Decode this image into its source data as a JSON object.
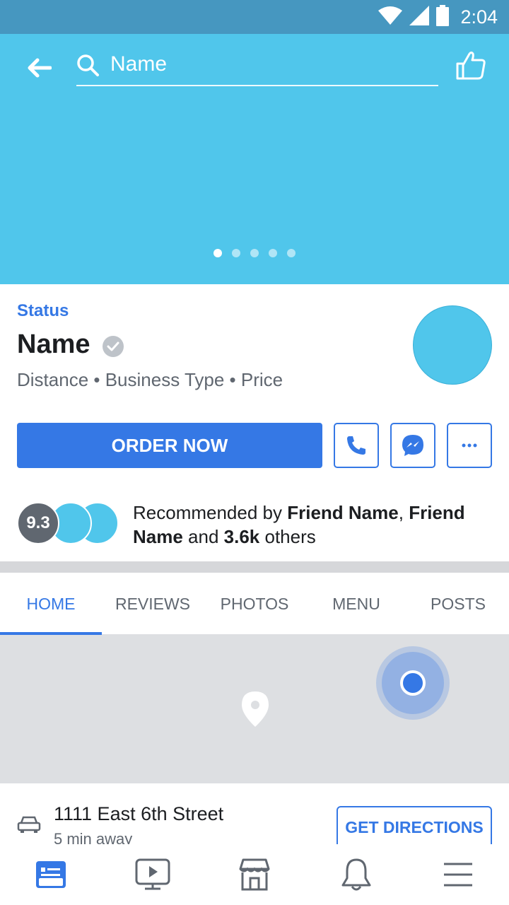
{
  "statusbar": {
    "time": "2:04",
    "icons": [
      "wifi-icon",
      "signal-icon",
      "battery-icon"
    ]
  },
  "header": {
    "search_text": "Name",
    "carousel": {
      "count": 5,
      "active": 0
    }
  },
  "info": {
    "status": "Status",
    "name": "Name",
    "meta": "Distance • Business Type • Price",
    "order_label": "ORDER NOW"
  },
  "recommend": {
    "score": "9.3",
    "prefix": "Recommended by ",
    "friend1": "Friend Name",
    "sep": ", ",
    "friend2": "Friend Name",
    "middle": " and ",
    "count": "3.6k",
    "suffix": " others"
  },
  "tabs": [
    {
      "label": "HOME",
      "active": true
    },
    {
      "label": "REVIEWS"
    },
    {
      "label": "PHOTOS"
    },
    {
      "label": "MENU"
    },
    {
      "label": "POSTS"
    }
  ],
  "address": {
    "line": "1111 East 6th Street",
    "sub": "5 min away",
    "directions_label": "GET DIRECTIONS"
  },
  "bottomnav": [
    "news-feed-icon",
    "watch-icon",
    "marketplace-icon",
    "notifications-icon",
    "menu-icon"
  ],
  "colors": {
    "accent": "#3578e5",
    "cover": "#50c6eb",
    "statusbar": "#4697c0"
  }
}
